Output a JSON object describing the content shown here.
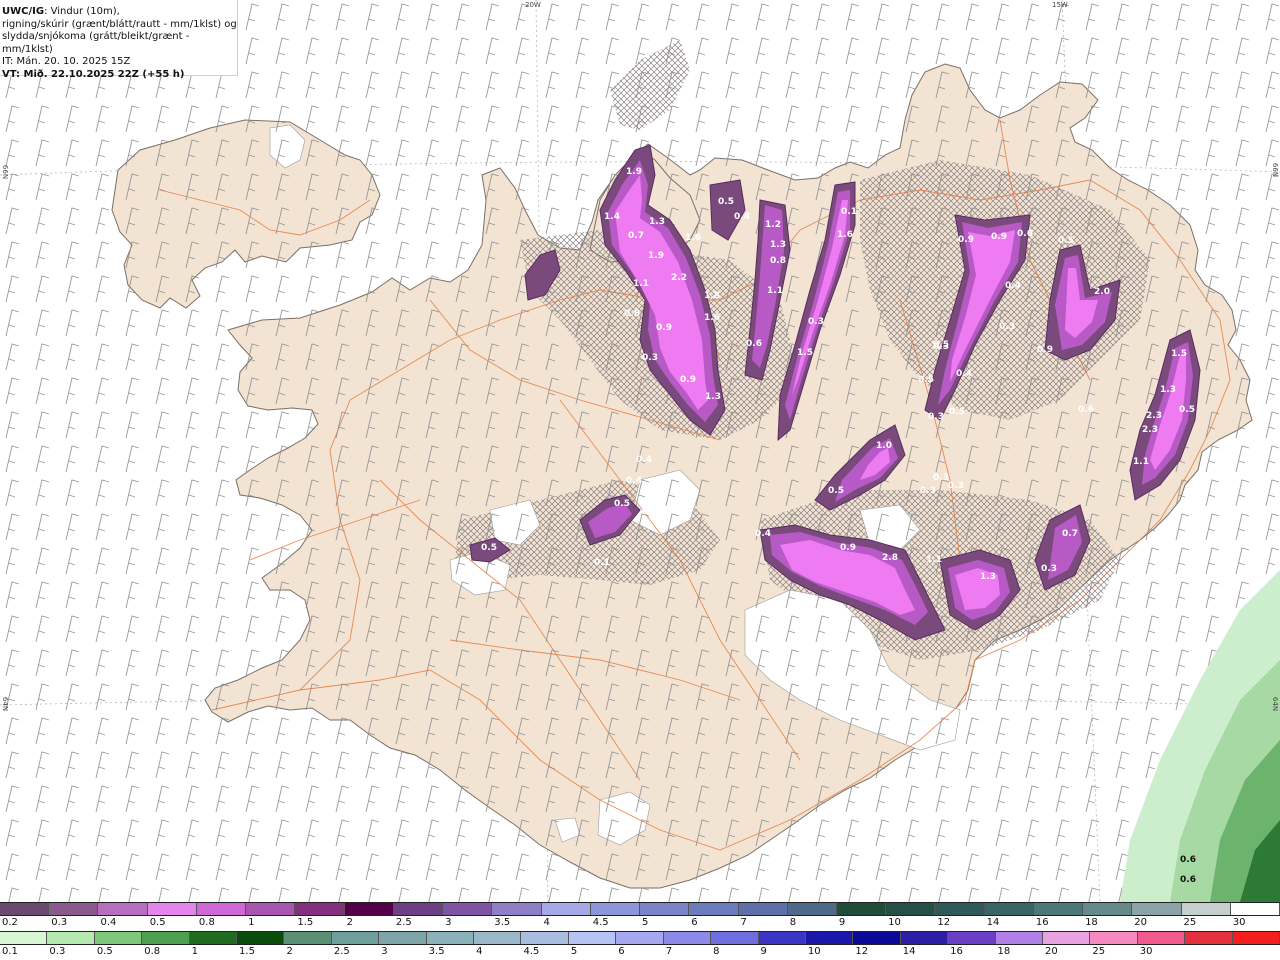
{
  "header": {
    "model": "UWC/IG",
    "line1_rest": ": Vindur (10m),",
    "line2": "rigning/skúrir (grænt/blátt/rautt - mm/1klst) og",
    "line3": "slydda/snjókoma (grátt/bleikt/grænt - mm/1klst)",
    "line4": "IT: Mán. 20. 10. 2025 15Z",
    "line5": "VT: Mið. 22.10.2025 22Z (+55 h)"
  },
  "coords": {
    "top_20w": "20W",
    "top_15w": "15W",
    "left_66n": "66N",
    "left_64n": "64N",
    "right_66n": "66N",
    "right_64n": "64N"
  },
  "precip_labels": [
    "1.9",
    "1.4",
    "0.7",
    "1.3",
    "1.9",
    "1.6",
    "2.2",
    "1.1",
    "1.8",
    "1.6",
    "0.8",
    "0.9",
    "0.3",
    "0.9",
    "1.3",
    "0.5",
    "0.4",
    "1.2",
    "1.3",
    "1.6",
    "0.8",
    "1.1",
    "0.3",
    "0.6",
    "1.5",
    "0.1",
    "0.9",
    "0.9",
    "0.6",
    "0.5",
    "0.4",
    "0.3",
    "0.3",
    "0.5",
    "0.4",
    "0.3",
    "0.5",
    "0.9",
    "2.0",
    "1.5",
    "1.3",
    "2.3",
    "2.3",
    "0.5",
    "1.1",
    "0.6",
    "0.4",
    "0.4",
    "0.5",
    "0.4",
    "0.5",
    "0.5",
    "0.1",
    "1.0",
    "0.5",
    "0.3",
    "0.3",
    "0.3",
    "0.4",
    "0.9",
    "2.8",
    "1.1",
    "1.3",
    "0.3",
    "0.7",
    "0.5"
  ],
  "green_labels": [
    "0.6",
    "0.6"
  ],
  "colors": {
    "land": "#f2e3d3",
    "sea": "#ffffff",
    "roads": "#e87a3c",
    "precip_dark": "#6a3a6e",
    "precip_mid": "#b75ac6",
    "precip_bright": "#ef7bf2",
    "rain_green": "#cdeecd"
  },
  "legend_snow": {
    "colors": [
      "#6b4a70",
      "#8b5a8c",
      "#b66fbe",
      "#e385ea",
      "#d067d6",
      "#a855b0",
      "#85307f",
      "#540049",
      "#6d3f84",
      "#7f54a4",
      "#8f7ec8",
      "#a6a9e6",
      "#8c96d8",
      "#7a84c9",
      "#6b7cbd",
      "#5f6fa8",
      "#4e6a8a",
      "#204d3a",
      "#245047",
      "#2f5a5a",
      "#3a6565",
      "#4d7878",
      "#648a8a",
      "#8ba3a6",
      "#c5cfd0",
      "#ffffff"
    ],
    "labels": [
      "0.2",
      "0.3",
      "0.4",
      "0.5",
      "0.8",
      "1",
      "1.5",
      "2",
      "2.5",
      "3",
      "3.5",
      "4",
      "4.5",
      "5",
      "6",
      "7",
      "8",
      "9",
      "10",
      "12",
      "14",
      "16",
      "18",
      "20",
      "25",
      "30"
    ]
  },
  "legend_rain": {
    "colors": [
      "#d8f5d4",
      "#b6e9b0",
      "#7ec87a",
      "#4e9f4e",
      "#1f6b1f",
      "#0a4d0a",
      "#5c8f73",
      "#6f9f9a",
      "#7da5a8",
      "#8ab2b8",
      "#9bb8c8",
      "#a8bde0",
      "#b6c4f3",
      "#a6a7f0",
      "#8d89e8",
      "#6f6de0",
      "#3c34c4",
      "#1c17ab",
      "#0b0a98",
      "#2c1fa3",
      "#6a3fc6",
      "#b07fe7",
      "#e8a2e0",
      "#f58ac0",
      "#f05a8c",
      "#e3313f",
      "#f31f1f"
    ],
    "labels": [
      "0.1",
      "0.3",
      "0.5",
      "0.8",
      "1",
      "1.5",
      "2",
      "2.5",
      "3",
      "3.5",
      "4",
      "4.5",
      "5",
      "6",
      "7",
      "8",
      "9",
      "10",
      "12",
      "14",
      "16",
      "18",
      "20",
      "25",
      "30"
    ]
  }
}
